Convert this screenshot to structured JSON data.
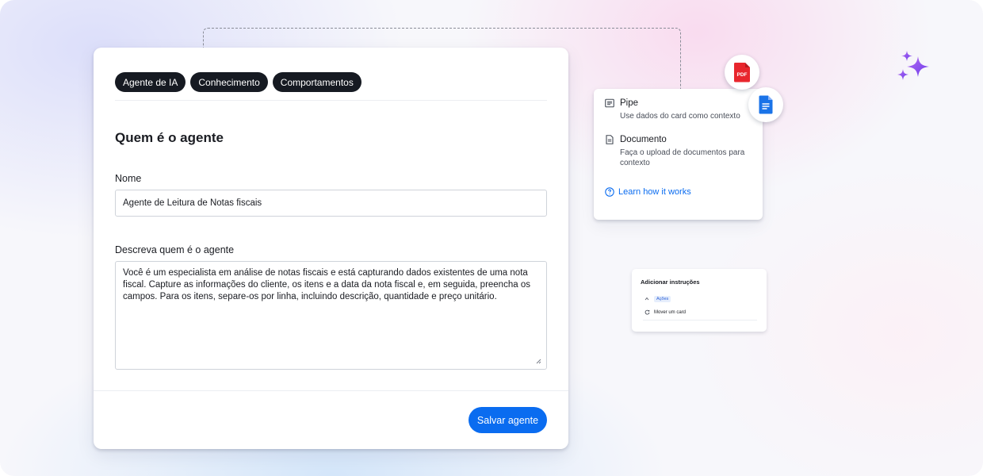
{
  "tabs": [
    {
      "label": "Agente de IA"
    },
    {
      "label": "Conhecimento"
    },
    {
      "label": "Comportamentos"
    }
  ],
  "form": {
    "section_title": "Quem é o agente",
    "name_label": "Nome",
    "name_value": "Agente de Leitura de Notas fiscais",
    "description_label": "Descreva quem é o agente",
    "description_value": "Você é um especialista em análise de notas fiscais e está capturando dados existentes de uma nota fiscal. Capture as informações do cliente, os itens e a data da nota fiscal e, em seguida, preencha os campos. Para os itens, separe-os por linha, incluindo descrição, quantidade e preço unitário.",
    "save_label": "Salvar agente"
  },
  "context_card": {
    "items": [
      {
        "title": "Pipe",
        "description": "Use dados do card como contexto",
        "icon": "list-icon"
      },
      {
        "title": "Documento",
        "description": "Faça o upload de documentos para contexto",
        "icon": "document-icon"
      }
    ],
    "learn_link": "Learn how it works"
  },
  "floating_icons": {
    "pdf_label": "PDF"
  },
  "instructions_card": {
    "title": "Adicionar instruções",
    "badge": "Ações",
    "item": "Mover um card"
  },
  "colors": {
    "primary": "#0a6cf0",
    "tab_bg": "#161a22",
    "pdf_red": "#e8262d",
    "gdoc_blue": "#1a73e8",
    "sparkle_purple": "#8b4dea"
  }
}
